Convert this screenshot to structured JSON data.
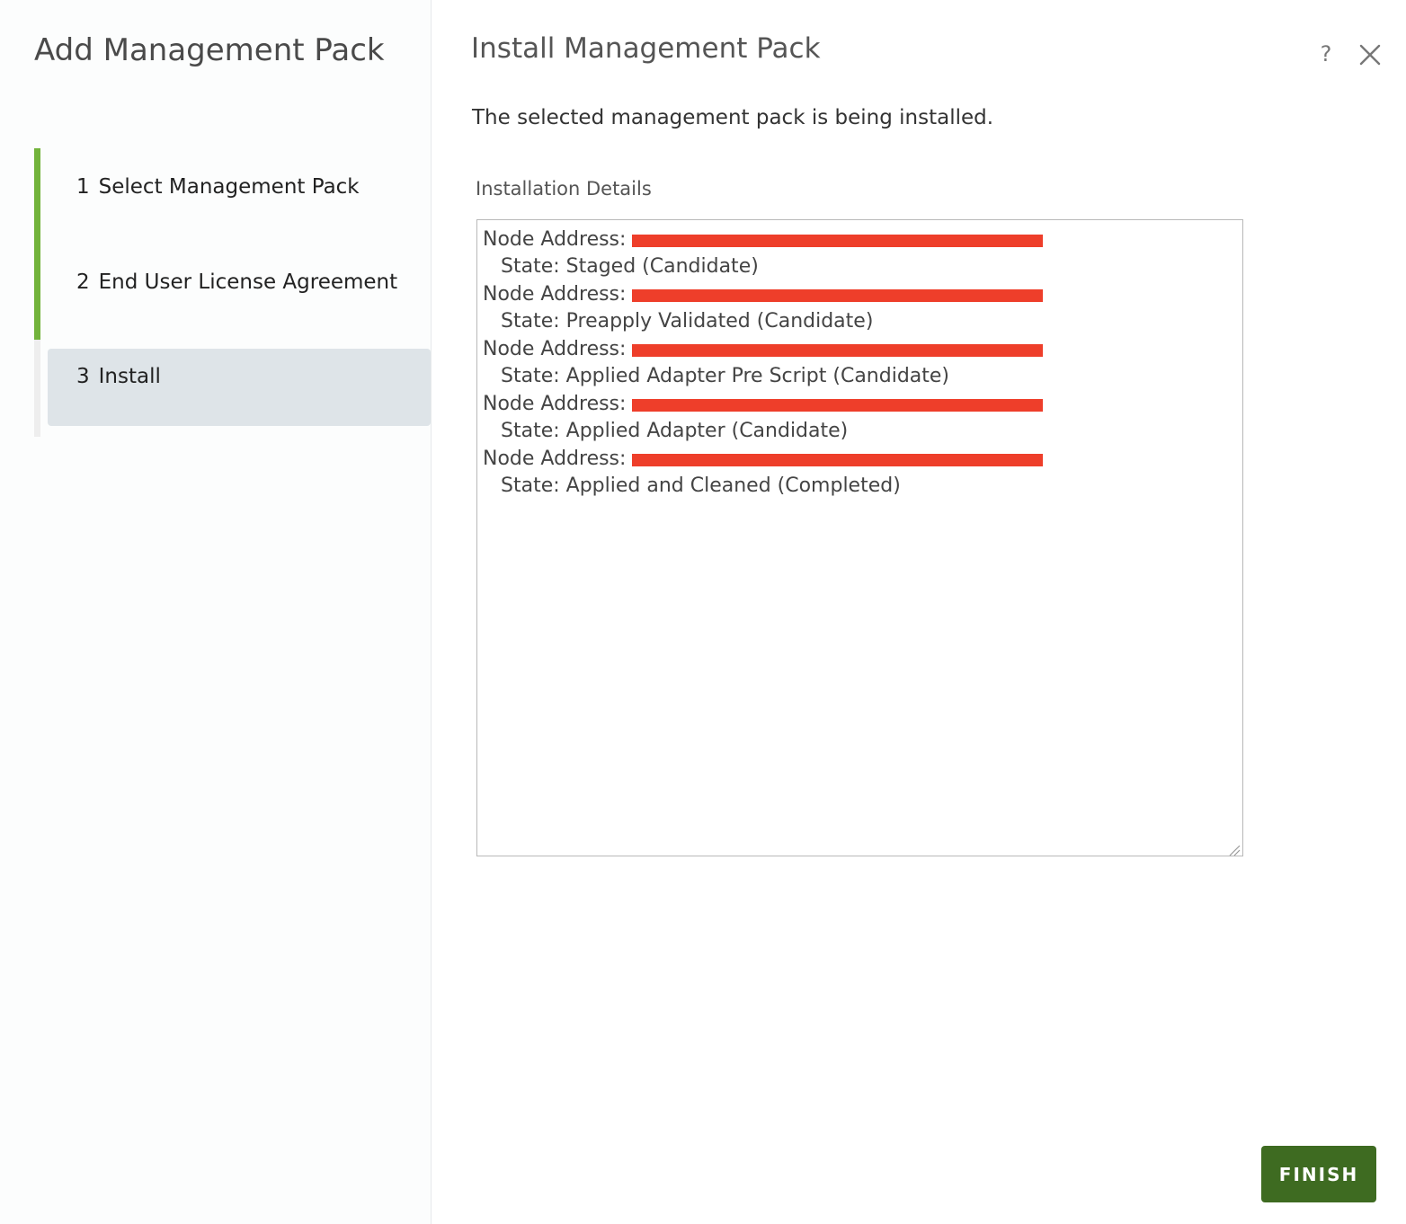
{
  "wizard": {
    "title": "Add Management Pack",
    "steps": [
      {
        "number": "1",
        "label": "Select Management Pack",
        "status": "completed"
      },
      {
        "number": "2",
        "label": "End User License Agreement",
        "status": "completed"
      },
      {
        "number": "3",
        "label": "Install",
        "status": "active"
      }
    ]
  },
  "main": {
    "title": "Install Management Pack",
    "description": "The selected management pack is being installed.",
    "details_label": "Installation Details",
    "entries": [
      {
        "address_label": "Node Address:",
        "state": "State: Staged (Candidate)"
      },
      {
        "address_label": "Node Address:",
        "state": "State: Preapply Validated (Candidate)"
      },
      {
        "address_label": "Node Address:",
        "state": "State: Applied Adapter Pre Script (Candidate)"
      },
      {
        "address_label": "Node Address:",
        "state": "State: Applied Adapter (Candidate)"
      },
      {
        "address_label": "Node Address:",
        "state": "State: Applied and Cleaned (Completed)"
      }
    ]
  },
  "header": {
    "help_icon_glyph": "?",
    "help_icon": "help-icon",
    "close_icon": "close-icon"
  },
  "footer": {
    "finish_label": "FINISH"
  },
  "colors": {
    "progress_done": "#72b33b",
    "active_step_bg": "#dee4e8",
    "finish_button": "#3e6b21",
    "redaction": "#ee3e2a"
  }
}
